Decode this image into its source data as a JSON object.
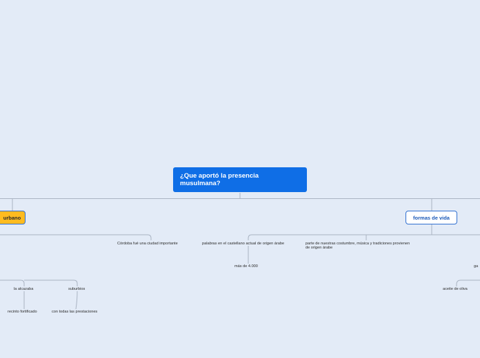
{
  "background": "#e3ebf7",
  "colors": {
    "root": "#0f6ee6",
    "branch_highlight": "#ffbb1f",
    "branch_border": "#2f6fd0",
    "connector": "#a9b3c2"
  },
  "root": {
    "text": "¿Que aportó la presencia musulmana?"
  },
  "branches": {
    "left": {
      "text": "urbano"
    },
    "right": {
      "text": "formas de vida"
    }
  },
  "topics": {
    "cordoba": "Córdoba fué una ciudad importante",
    "palabras": "palabras en el castellano actual de origen árabe",
    "mas4000": "más de 4.000",
    "costumbres_1": "parte de nuestras costumbre, música y tradiciones provienen",
    "costumbres_2": "de origen árabe",
    "alcazaba": "la alcazaba",
    "suburbios": "suburbios",
    "recinto": "recinto fortificado",
    "prestaciones": "con todas las prestaciones",
    "aceite": "aceite de oliva",
    "ga": "ga"
  }
}
